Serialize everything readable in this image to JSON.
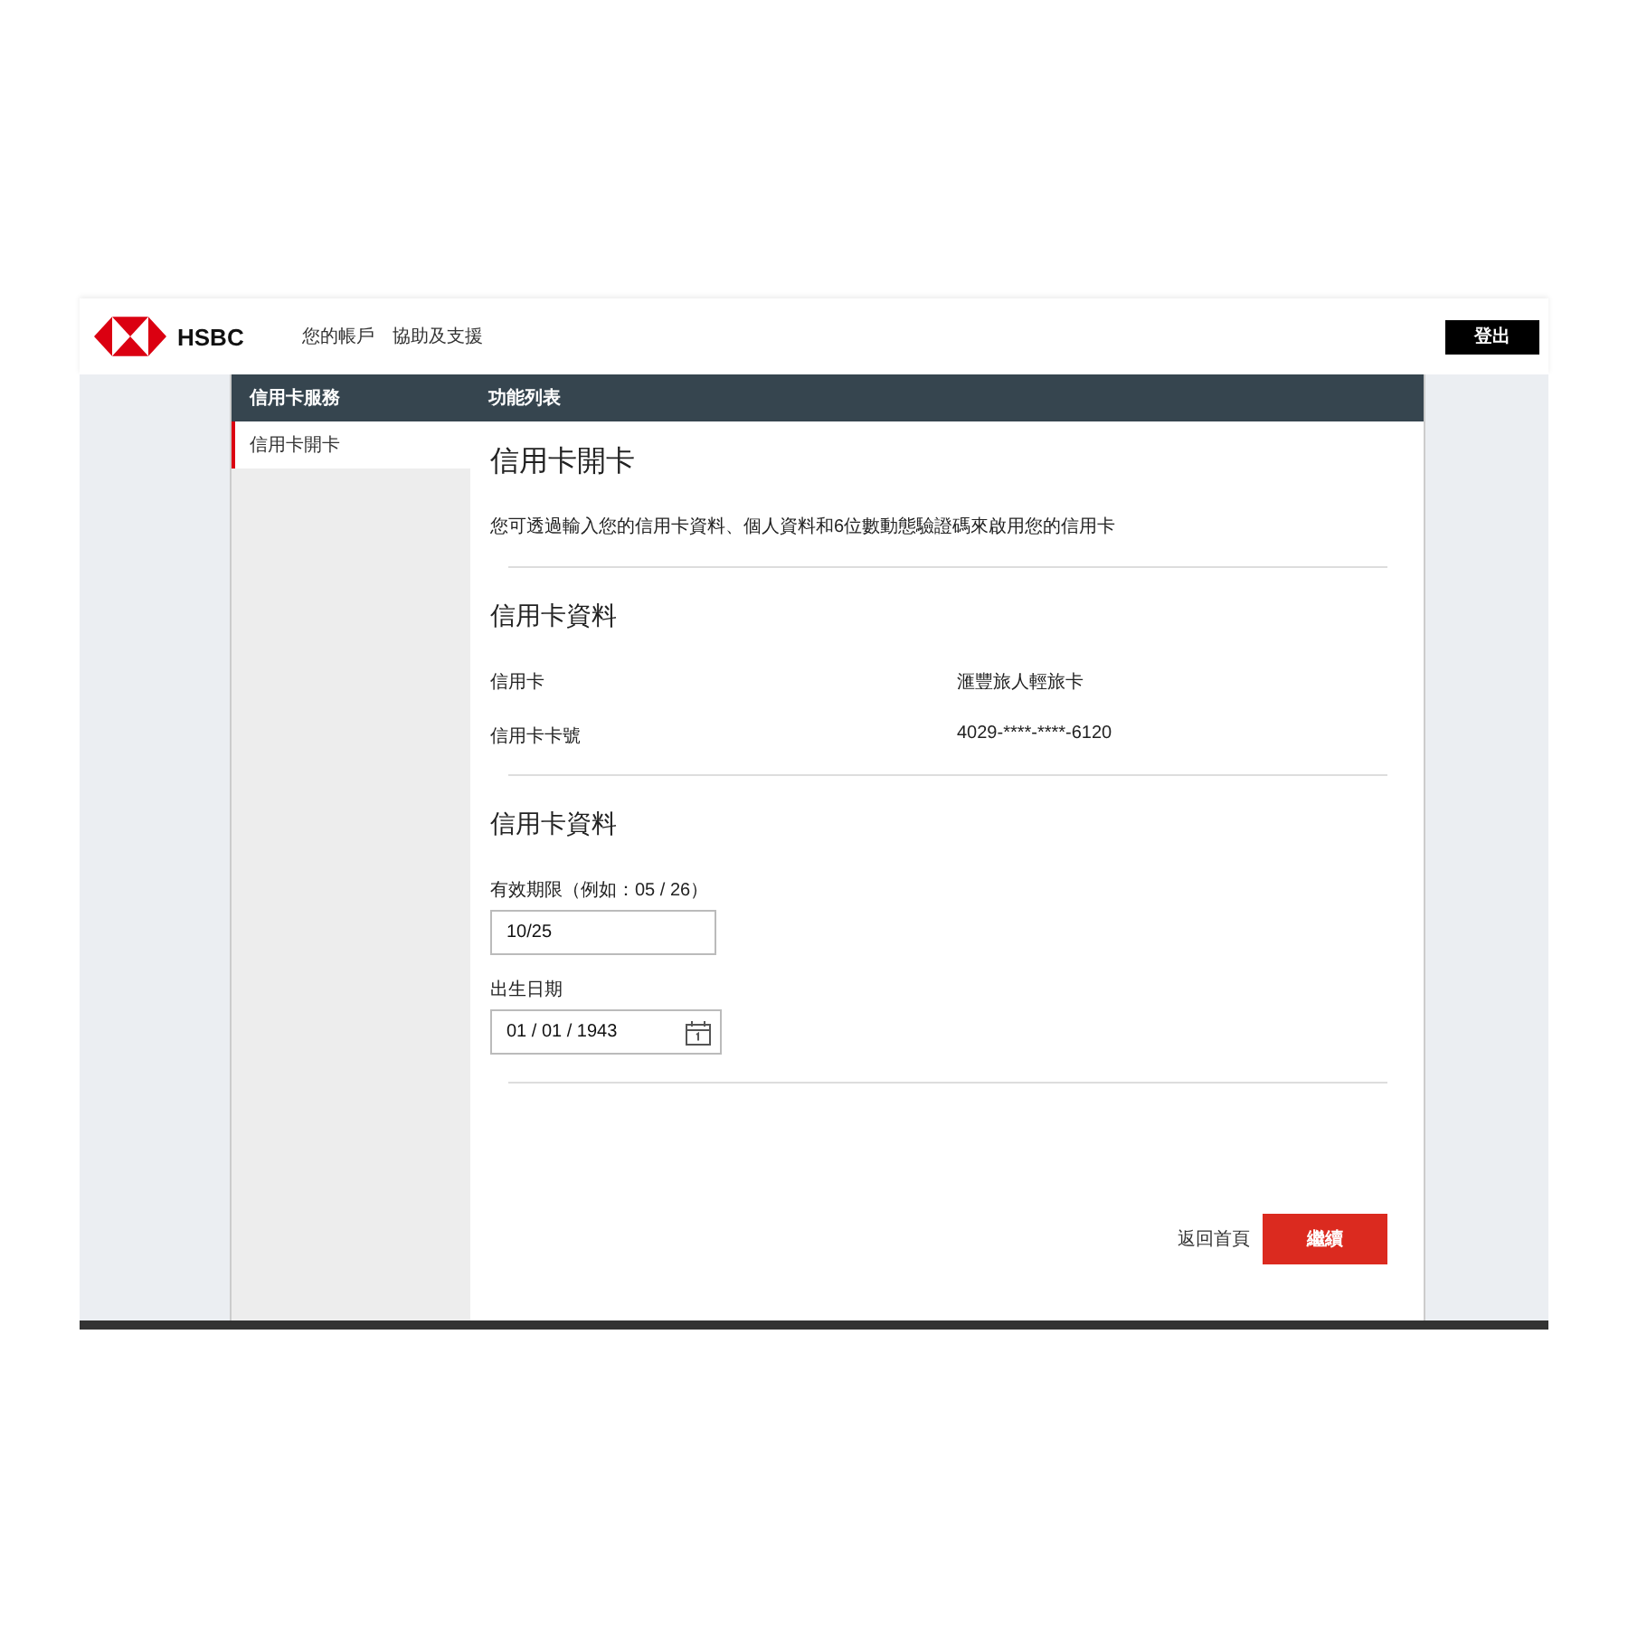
{
  "header": {
    "brand": "HSBC",
    "nav": [
      "您的帳戶",
      "協助及支援"
    ],
    "logout": "登出"
  },
  "title_bar": {
    "sidebar_title": "信用卡服務",
    "main_title": "功能列表"
  },
  "sidebar": {
    "items": [
      {
        "label": "信用卡開卡",
        "selected": true
      }
    ]
  },
  "page": {
    "title": "信用卡開卡",
    "intro": "您可透過輸入您的信用卡資料、個人資料和6位數動態驗證碼來啟用您的信用卡",
    "card_section": {
      "heading": "信用卡資料",
      "rows": [
        {
          "label": "信用卡",
          "value": "滙豐旅人輕旅卡"
        },
        {
          "label": "信用卡卡號",
          "value": "4029-****-****-6120"
        }
      ]
    },
    "form_section": {
      "heading": "信用卡資料",
      "fields": [
        {
          "kind": "text",
          "label": "有效期限（例如：05 / 26）",
          "value": "10/25"
        },
        {
          "kind": "date",
          "label": "出生日期",
          "value": "01 / 01 / 1943"
        }
      ]
    },
    "actions": {
      "back": "返回首頁",
      "continue": "繼續"
    }
  }
}
